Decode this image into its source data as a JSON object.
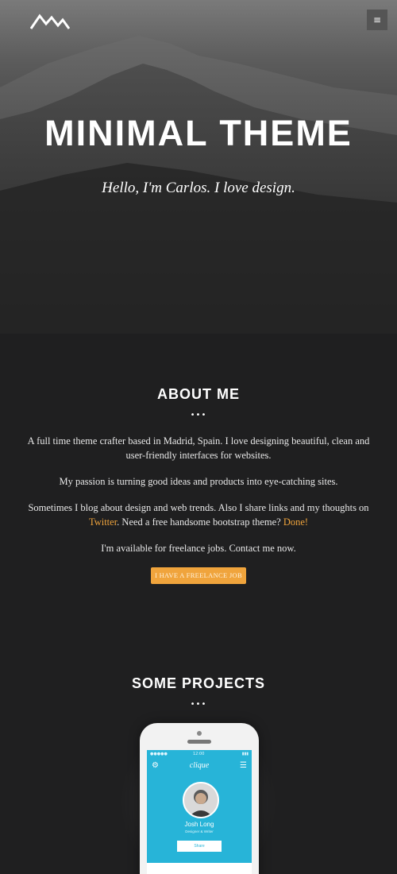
{
  "nav": {
    "logo_icon": "mountain-logo-icon",
    "menu_icon": "hamburger-menu-icon",
    "menu_label": "≡"
  },
  "hero": {
    "title": "MINIMAL THEME",
    "subtitle": "Hello, I'm Carlos. I love design."
  },
  "about": {
    "title": "ABOUT ME",
    "divider": "•••",
    "para1": "A full time theme crafter based in Madrid, Spain. I love designing beautiful, clean and user-friendly interfaces for websites.",
    "para2": "My passion is turning good ideas and products into eye-catching sites.",
    "para3_before": "Sometimes I blog about design and web trends. Also I share links and my thoughts on",
    "para3_link1": "Twitter",
    "para3_middle": ". Need a free handsome bootstrap theme?",
    "para3_link2": "Done!",
    "para4": "I'm available for freelance jobs. Contact me now.",
    "cta_label": "I HAVE A FREELANCE JOB"
  },
  "projects": {
    "title": "SOME PROJECTS",
    "divider": "•••",
    "phone": {
      "app_title": "clique",
      "gear_icon": "⚙",
      "menu_icon": "☰",
      "profile_name": "Josh Long",
      "profile_role": "Designer & Writer",
      "button_label": "Share",
      "status_signal": "●●●●●",
      "status_time": "12:00",
      "status_battery": "▮▮▮"
    }
  },
  "colors": {
    "background": "#1f1f20",
    "accent": "#f0a43c",
    "phone_screen": "#27b4d8",
    "text": "#ffffff"
  }
}
